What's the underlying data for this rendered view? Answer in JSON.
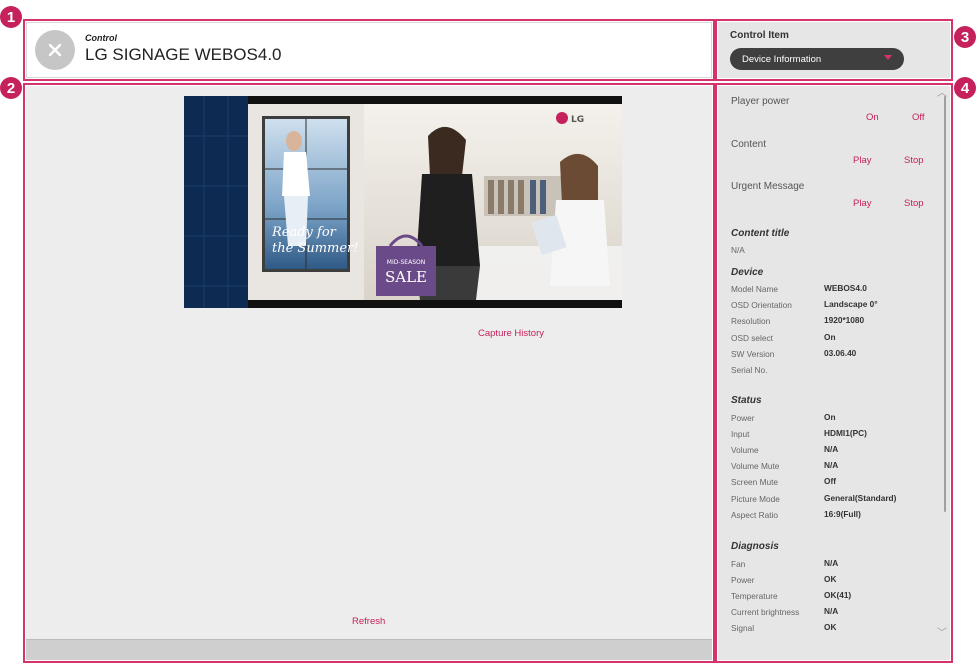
{
  "markers": [
    "1",
    "2",
    "3",
    "4"
  ],
  "header": {
    "small_label": "Control",
    "title": "LG SIGNAGE WEBOS4.0"
  },
  "control_item": {
    "label": "Control Item",
    "selected": "Device Information"
  },
  "main": {
    "capture_history": "Capture History",
    "refresh": "Refresh",
    "preview": {
      "brand": "LG",
      "sign_text": [
        "Ready for",
        "the Summer!"
      ],
      "bag_small": "MID-SEASON",
      "bag_text": "SALE"
    }
  },
  "controls": {
    "player_power": {
      "label": "Player power",
      "on": "On",
      "off": "Off"
    },
    "content": {
      "label": "Content",
      "play": "Play",
      "stop": "Stop"
    },
    "urgent": {
      "label": "Urgent Message",
      "play": "Play",
      "stop": "Stop"
    }
  },
  "content_title": {
    "heading": "Content title",
    "value": "N/A"
  },
  "device": {
    "heading": "Device",
    "rows": [
      {
        "k": "Model Name",
        "v": "WEBOS4.0"
      },
      {
        "k": "OSD Orientation",
        "v": "Landscape 0°"
      },
      {
        "k": "Resolution",
        "v": "1920*1080"
      },
      {
        "k": "OSD select",
        "v": "On"
      },
      {
        "k": "SW Version",
        "v": "03.06.40"
      },
      {
        "k": "Serial No.",
        "v": ""
      }
    ]
  },
  "status": {
    "heading": "Status",
    "rows": [
      {
        "k": "Power",
        "v": "On"
      },
      {
        "k": "Input",
        "v": "HDMI1(PC)"
      },
      {
        "k": "Volume",
        "v": "N/A"
      },
      {
        "k": "Volume Mute",
        "v": "N/A"
      },
      {
        "k": "Screen Mute",
        "v": "Off"
      },
      {
        "k": "Picture Mode",
        "v": "General(Standard)"
      },
      {
        "k": "Aspect Ratio",
        "v": "16:9(Full)"
      }
    ]
  },
  "diagnosis": {
    "heading": "Diagnosis",
    "rows": [
      {
        "k": "Fan",
        "v": "N/A"
      },
      {
        "k": "Power",
        "v": "OK"
      },
      {
        "k": "Temperature",
        "v": "OK(41)"
      },
      {
        "k": "Current brightness",
        "v": "N/A"
      },
      {
        "k": "Signal",
        "v": "OK"
      }
    ]
  },
  "colors": {
    "accent": "#c5215c",
    "outline": "#d4336e",
    "panel": "#e6e6e6"
  }
}
